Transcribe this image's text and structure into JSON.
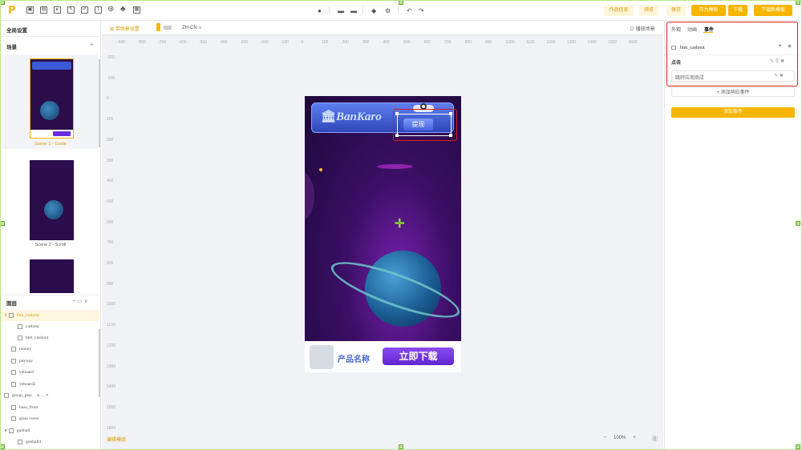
{
  "toolbar": {
    "logo": "P",
    "left_icons": [
      "image-icon",
      "image-icon",
      "video-icon",
      "edit-icon",
      "edit-icon",
      "text-icon",
      "palette-icon",
      "puzzle-icon",
      "grid-icon"
    ],
    "center_icons": [
      "shape-icon",
      "align-icon",
      "align-icon",
      "align-icon",
      "gear-icon",
      "undo-icon",
      "redo-icon"
    ],
    "buttons": {
      "project_info": "作品信息",
      "preview": "预览",
      "save": "保存",
      "save_template": "存为模板",
      "download": "下载",
      "download_group": "下载新模板"
    }
  },
  "left": {
    "global_settings": "全局设置",
    "scenes_title": "场景",
    "add_scene": "+",
    "scenes": [
      {
        "label": "Scene 1 - Guide",
        "active": true
      },
      {
        "label": "Scene 2 - Scroll",
        "active": false
      },
      {
        "label": "",
        "active": false
      }
    ],
    "layers_title": "图层",
    "layers": [
      {
        "name": "btm_cashout",
        "type": "folder",
        "level": 0,
        "selected": true
      },
      {
        "name": "cashout",
        "type": "text",
        "level": 1
      },
      {
        "name": "btm_cashout",
        "type": "image",
        "level": 1
      },
      {
        "name": "money",
        "type": "text",
        "level": 0
      },
      {
        "name": "payway",
        "type": "image",
        "level": 0
      },
      {
        "name": "yeboard",
        "type": "image",
        "level": 0
      },
      {
        "name": "yeboard2",
        "type": "image",
        "level": 0
      },
      {
        "name": "group_play",
        "type": "folder",
        "level": 0
      },
      {
        "name": "base_front",
        "type": "image",
        "level": 0
      },
      {
        "name": "glass cover",
        "type": "image",
        "level": 0
      },
      {
        "name": "gunball",
        "type": "folder",
        "level": 0
      },
      {
        "name": "gunball4",
        "type": "image",
        "level": 1
      }
    ]
  },
  "canvas": {
    "tab_label": "带场景设置",
    "lang": "ZH-CN",
    "play_scene": "播放场景",
    "ruler_x": [
      "-900",
      "-800",
      "-700",
      "-600",
      "-500",
      "-400",
      "-300",
      "-200",
      "-100",
      "0",
      "100",
      "200",
      "300",
      "400",
      "500",
      "600",
      "700",
      "800",
      "900",
      "1000",
      "1100",
      "1200",
      "1300",
      "1400",
      "1500",
      "1600"
    ],
    "ruler_y": [
      "-200",
      "-100",
      "0",
      "100",
      "200",
      "300",
      "400",
      "500",
      "600",
      "700",
      "800",
      "900",
      "1000",
      "1100",
      "1200",
      "1300",
      "1400",
      "1500",
      "1600"
    ],
    "bottom_left": "编辑模组",
    "zoom": "100%",
    "game": {
      "bank_text": "BanKaro",
      "cash_button": "提现",
      "product_name": "产品名称",
      "download_cta": "立即下载"
    }
  },
  "right": {
    "tabs": [
      "外观",
      "动画",
      "事件"
    ],
    "active_tab": "事件",
    "object_name": "btm_cashout",
    "event_label": "点击",
    "action_label": "跳转应用商店",
    "add_response": "+ 添加响应事件",
    "add_event": "添加事件"
  },
  "colors": {
    "accent": "#f7b500",
    "highlight": "#e01b1b",
    "selection_handle": "#b8e58c"
  }
}
